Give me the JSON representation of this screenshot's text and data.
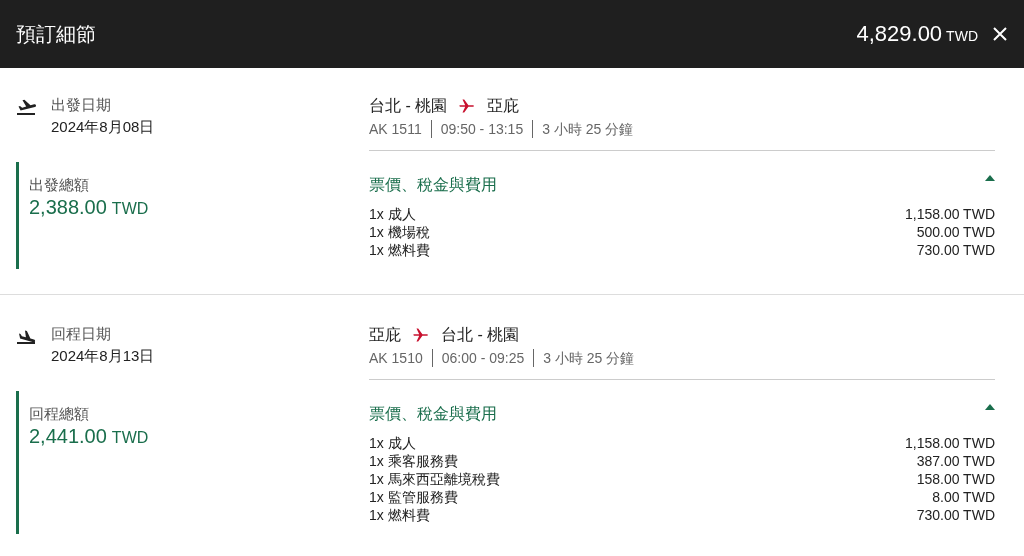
{
  "header": {
    "title": "預訂細節",
    "total_amount": "4,829.00",
    "total_currency": "TWD"
  },
  "segments": [
    {
      "kind": "departure",
      "date_label": "出發日期",
      "date": "2024年8月08日",
      "origin": "台北 - 桃園",
      "destination": "亞庇",
      "flight": "AK 1511",
      "time": "09:50 - 13:15",
      "duration": "3 小時 25 分鐘",
      "total_label": "出發總額",
      "total_amount": "2,388.00",
      "total_currency": "TWD",
      "fees_title": "票價、稅金與費用",
      "expanded": true,
      "fees": [
        {
          "name": "1x 成人",
          "amount": "1,158.00 TWD"
        },
        {
          "name": "1x 機場稅",
          "amount": "500.00 TWD"
        },
        {
          "name": "1x 燃料費",
          "amount": "730.00 TWD"
        }
      ]
    },
    {
      "kind": "return",
      "date_label": "回程日期",
      "date": "2024年8月13日",
      "origin": "亞庇",
      "destination": "台北 - 桃園",
      "flight": "AK 1510",
      "time": "06:00 - 09:25",
      "duration": "3 小時 25 分鐘",
      "total_label": "回程總額",
      "total_amount": "2,441.00",
      "total_currency": "TWD",
      "fees_title": "票價、稅金與費用",
      "expanded": true,
      "fees": [
        {
          "name": "1x 成人",
          "amount": "1,158.00 TWD"
        },
        {
          "name": "1x 乘客服務費",
          "amount": "387.00 TWD"
        },
        {
          "name": "1x 馬來西亞離境稅費",
          "amount": "158.00 TWD"
        },
        {
          "name": "1x 監管服務費",
          "amount": "8.00 TWD"
        },
        {
          "name": "1x 燃料費",
          "amount": "730.00 TWD"
        }
      ]
    }
  ]
}
